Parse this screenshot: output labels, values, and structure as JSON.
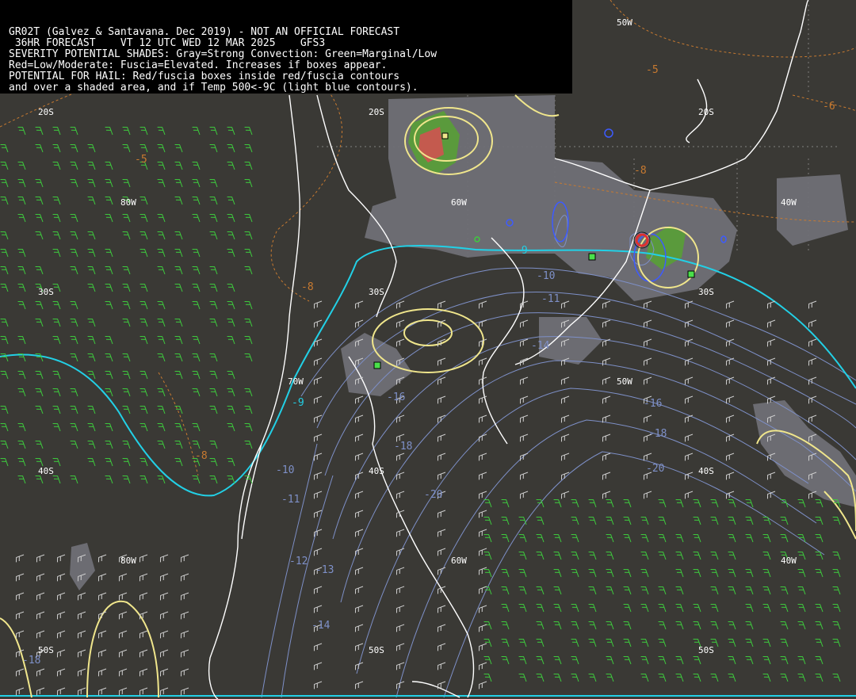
{
  "header": {
    "lines": [
      "GR02T (Galvez & Santavana. Dec 2019) - NOT AN OFFICIAL FORECAST",
      " 36HR FORECAST    VT 12 UTC WED 12 MAR 2025    GFS3",
      "SEVERITY POTENTIAL SHADES: Gray=Strong Convection: Green=Marginal/Low",
      "Red=Low/Moderate: Fuscia=Elevated. Increases if boxes appear.",
      "POTENTIAL FOR HAIL: Red/fuscia boxes inside red/fuscia contours",
      "and over a shaded area, and if Temp 500<-9C (light blue contours)."
    ]
  },
  "graticule_labels": [
    {
      "text": "20S"
    },
    {
      "text": "20S"
    },
    {
      "text": "20S"
    },
    {
      "text": "30S"
    },
    {
      "text": "30S"
    },
    {
      "text": "30S"
    },
    {
      "text": "40S"
    },
    {
      "text": "40S"
    },
    {
      "text": "40S"
    },
    {
      "text": "50S"
    },
    {
      "text": "50S"
    },
    {
      "text": "50S"
    },
    {
      "text": "80W"
    },
    {
      "text": "80W"
    },
    {
      "text": "70W"
    },
    {
      "text": "60W"
    },
    {
      "text": "60W"
    },
    {
      "text": "50W"
    },
    {
      "text": "50W"
    },
    {
      "text": "40W"
    },
    {
      "text": "40W"
    }
  ],
  "temperature_labels": {
    "orange": [
      "-5",
      "-5",
      "-6",
      "-8",
      "-8",
      "-8"
    ],
    "blue": [
      "-9",
      "-9",
      "-10",
      "-10",
      "-11",
      "-11",
      "-12",
      "-13",
      "-14",
      "-14",
      "-16",
      "-16",
      "-18",
      "-18",
      "-18",
      "-20",
      "-20"
    ]
  },
  "colors": {
    "background": "#3a3935",
    "header_bg": "#000000",
    "coast": "#ffffff",
    "gray_shade": "#6f6f76",
    "green_shade": "#5a9a3c",
    "red_shade": "#c45a4e",
    "yellow_contour": "#f0e68c",
    "cyan_contour": "#22d0e6",
    "blue_contour": "#7e90c8",
    "orange_contour": "#c87a30",
    "wind_green": "#3ecc3e",
    "wind_white": "#d8d8d8"
  }
}
